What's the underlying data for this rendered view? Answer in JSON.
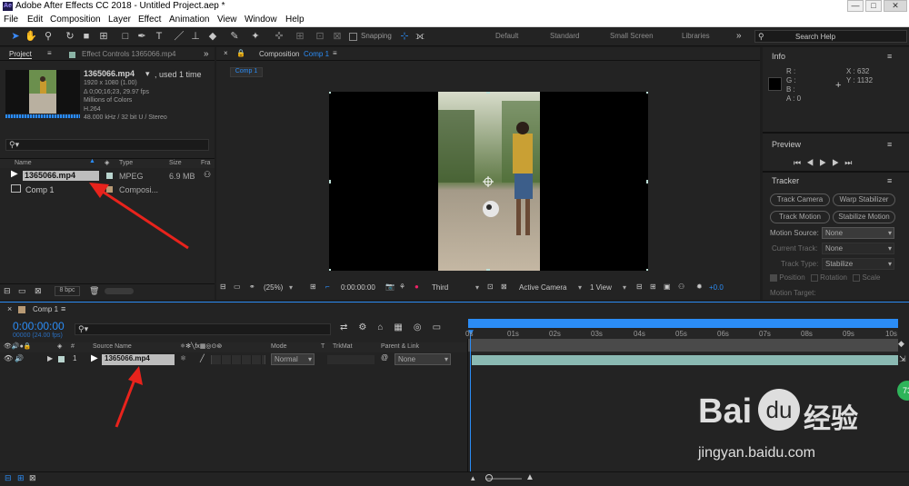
{
  "window": {
    "app_icon": "Ae",
    "title": "Adobe After Effects CC 2018 - Untitled Project.aep *",
    "controls": [
      "—",
      "□",
      "✕"
    ]
  },
  "menu": [
    "File",
    "Edit",
    "Composition",
    "Layer",
    "Effect",
    "Animation",
    "View",
    "Window",
    "Help"
  ],
  "toolbar": {
    "snapping_label": "Snapping",
    "workspaces": [
      "Default",
      "Standard",
      "Small Screen",
      "Libraries"
    ],
    "search_placeholder": "Search Help"
  },
  "project": {
    "tab_label": "Project",
    "effect_controls_label": "Effect Controls 1365066.mp4",
    "file_name": "1365066.mp4",
    "used_text": ", used 1 time",
    "info_lines": [
      "1920 x 1080 (1.00)",
      "Δ 0;00;16;23, 29.97 fps",
      "Millions of Colors",
      "H.264",
      "48.000 kHz / 32 bit U / Stereo"
    ],
    "search_placeholder": "",
    "columns": [
      "Name",
      "Type",
      "Size",
      "Fra"
    ],
    "items": [
      {
        "name": "1365066.mp4",
        "type": "MPEG",
        "size": "6.9 MB"
      },
      {
        "name": "Comp 1",
        "type": "Composi...",
        "size": ""
      }
    ],
    "bpc": "8 bpc"
  },
  "composition": {
    "tab_prefix": "Composition",
    "tab_name": "Comp 1",
    "sub_tab": "Comp 1",
    "zoom": "(25%)",
    "timecode": "0:00:00:00",
    "view_mode": "Third",
    "camera": "Active Camera",
    "views": "1 View",
    "exposure": "+0.0"
  },
  "info": {
    "title": "Info",
    "channels": [
      "R :",
      "G :",
      "B :",
      "A : 0"
    ],
    "x": "X : 632",
    "y": "Y : 1132"
  },
  "preview": {
    "title": "Preview"
  },
  "tracker": {
    "title": "Tracker",
    "buttons": [
      "Track Camera",
      "Warp Stabilizer",
      "Track Motion",
      "Stabilize Motion"
    ],
    "motion_source_label": "Motion Source:",
    "motion_source": "None",
    "current_track_label": "Current Track:",
    "current_track": "None",
    "track_type_label": "Track Type:",
    "track_type": "Stabilize",
    "options": [
      "Position",
      "Rotation",
      "Scale"
    ],
    "motion_target_label": "Motion Target:"
  },
  "timeline": {
    "tab_label": "Comp 1",
    "timecode": "0:00:00:00",
    "frame_info": "00000 (24.00 fps)",
    "search_placeholder": "",
    "columns": {
      "source_name": "Source Name",
      "mode": "Mode",
      "t": "T",
      "trkmat": "TrkMat",
      "parent": "Parent & Link"
    },
    "layer": {
      "number": "1",
      "name": "1365066.mp4",
      "mode": "Normal",
      "parent": "None"
    },
    "ruler": [
      "0s",
      "01s",
      "02s",
      "03s",
      "04s",
      "05s",
      "06s",
      "07s",
      "08s",
      "09s",
      "10s"
    ]
  },
  "watermark": {
    "brand": "Bai",
    "brand_cn": "经验",
    "url": "jingyan.baidu.com"
  },
  "colors": {
    "accent": "#2b8cf5",
    "arrow": "#e8231c",
    "teal_badge": "#2fb45a"
  }
}
